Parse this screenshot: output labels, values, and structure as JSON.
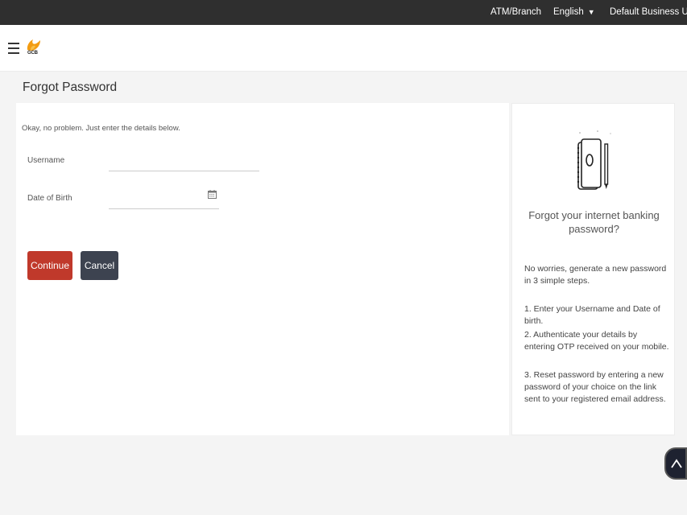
{
  "topbar": {
    "atm_branch": "ATM/Branch",
    "language": "English",
    "business_unit": "Default Business Unit"
  },
  "header": {
    "logo_text": "GCB"
  },
  "page": {
    "title": "Forgot Password"
  },
  "form": {
    "intro": "Okay, no problem. Just enter the details below.",
    "username_label": "Username",
    "username_value": "",
    "dob_label": "Date of Birth",
    "dob_value": "",
    "continue_label": "Continue",
    "cancel_label": "Cancel"
  },
  "side_panel": {
    "heading": "Forgot your internet banking password?",
    "intro": "No worries, generate a new password in 3 simple steps.",
    "steps": [
      "1. Enter your Username and Date of birth.",
      "2. Authenticate your details by entering OTP received on your mobile.",
      "3. Reset password by entering a new password of your choice on the link sent to your registered email address."
    ]
  },
  "icons": {
    "menu": "hamburger-icon",
    "calendar": "calendar-icon",
    "scroll_top": "chevron-up-icon",
    "notebook": "notebook-icon"
  },
  "colors": {
    "topbar": "#2f2f2f",
    "continue": "#c0392b",
    "cancel": "#3d4350",
    "logo_accent": "#f39c12"
  }
}
